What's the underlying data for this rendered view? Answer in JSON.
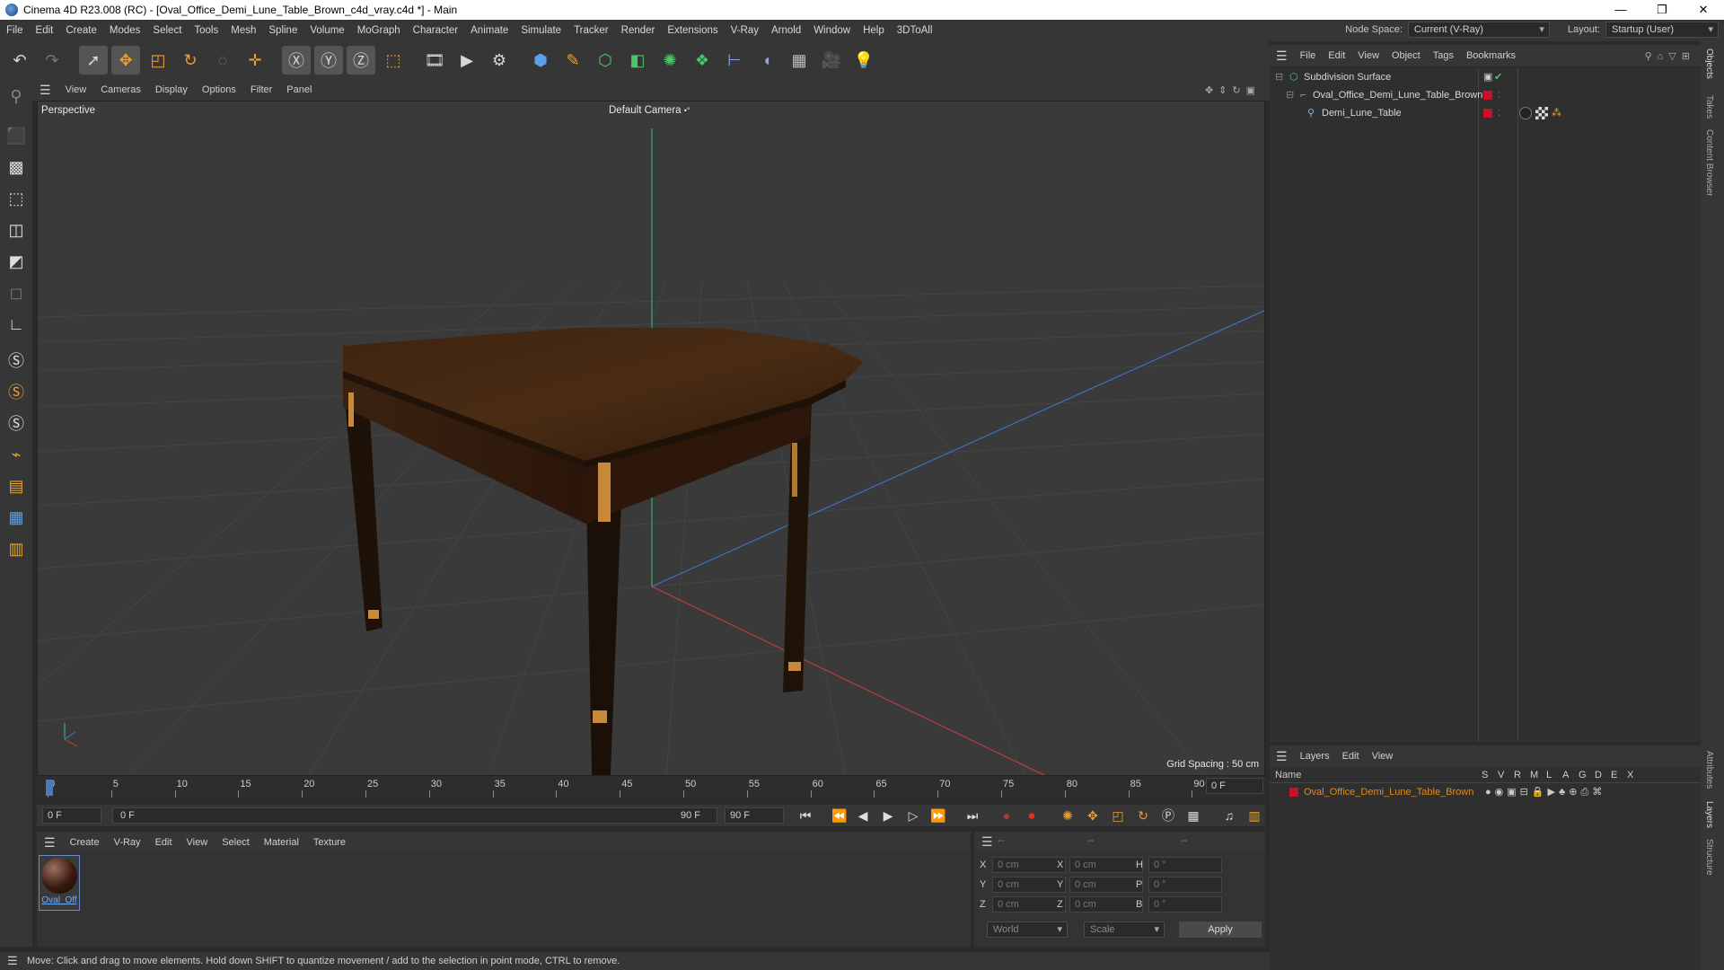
{
  "window": {
    "title": "Cinema 4D R23.008 (RC) - [Oval_Office_Demi_Lune_Table_Brown_c4d_vray.c4d *] - Main",
    "controls": [
      "—",
      "❐",
      "✕"
    ]
  },
  "menubar": {
    "items": [
      "File",
      "Edit",
      "Create",
      "Modes",
      "Select",
      "Tools",
      "Mesh",
      "Spline",
      "Volume",
      "MoGraph",
      "Character",
      "Animate",
      "Simulate",
      "Tracker",
      "Render",
      "Extensions",
      "V-Ray",
      "Arnold",
      "Window",
      "Help",
      "3DToAll"
    ],
    "node_space_label": "Node Space:",
    "node_space_value": "Current (V-Ray)",
    "layout_label": "Layout:",
    "layout_value": "Startup (User)"
  },
  "toolbar": {
    "icons": [
      "undo-icon",
      "redo-icon",
      "select-icon",
      "move-icon",
      "scale-icon",
      "rotate-icon",
      "live-select-icon",
      "axis-icon",
      "x-axis-icon",
      "y-axis-icon",
      "z-axis-icon",
      "coord-icon",
      "render-region-icon",
      "render-view-icon",
      "render-settings-icon",
      "cube-icon",
      "pen-icon",
      "subdivision-icon",
      "extrude-icon",
      "cloner-icon",
      "voronoi-icon",
      "ik-icon",
      "deformer-icon",
      "floor-icon",
      "camera-icon",
      "light-icon"
    ]
  },
  "viewport": {
    "menu": [
      "View",
      "Cameras",
      "Display",
      "Options",
      "Filter",
      "Panel"
    ],
    "label": "Perspective",
    "camera": "Default Camera",
    "camera_icon": "•°",
    "grid_spacing": "Grid Spacing : 50 cm"
  },
  "timeline": {
    "ticks": [
      "0",
      "5",
      "10",
      "15",
      "20",
      "25",
      "30",
      "35",
      "40",
      "45",
      "50",
      "55",
      "60",
      "65",
      "70",
      "75",
      "80",
      "85",
      "90"
    ],
    "frame_field": "0 F"
  },
  "transport": {
    "start": "0 F",
    "range_start": "0 F",
    "range_end": "90 F",
    "end": "90 F"
  },
  "materials": {
    "menu": [
      "Create",
      "V-Ray",
      "Edit",
      "View",
      "Select",
      "Material",
      "Texture"
    ],
    "items": [
      {
        "name": "Oval_Off"
      }
    ]
  },
  "coords": {
    "headers": [
      "--",
      "--",
      "--"
    ],
    "rows": [
      {
        "a": "X",
        "av": "0 cm",
        "b": "X",
        "bv": "0 cm",
        "c": "H",
        "cv": "0 °"
      },
      {
        "a": "Y",
        "av": "0 cm",
        "b": "Y",
        "bv": "0 cm",
        "c": "P",
        "cv": "0 °"
      },
      {
        "a": "Z",
        "av": "0 cm",
        "b": "Z",
        "bv": "0 cm",
        "c": "B",
        "cv": "0 °"
      }
    ],
    "mode1": "World",
    "mode2": "Scale",
    "apply": "Apply"
  },
  "status": "Move: Click and drag to move elements. Hold down SHIFT to quantize movement / add to the selection in point mode, CTRL to remove.",
  "objects": {
    "menu": [
      "File",
      "Edit",
      "View",
      "Object",
      "Tags",
      "Bookmarks"
    ],
    "rows": [
      {
        "name": "Subdivision Surface"
      },
      {
        "name": "Oval_Office_Demi_Lune_Table_Brown"
      },
      {
        "name": "Demi_Lune_Table"
      }
    ]
  },
  "layers": {
    "menu": [
      "Layers",
      "Edit",
      "View"
    ],
    "name_header": "Name",
    "flags": [
      "S",
      "V",
      "R",
      "M",
      "L",
      "A",
      "G",
      "D",
      "E",
      "X"
    ],
    "rows": [
      {
        "name": "Oval_Office_Demi_Lune_Table_Brown"
      }
    ]
  },
  "side_tabs": [
    "Objects",
    "Takes",
    "Content Browser",
    "Attributes",
    "Layers",
    "Structure"
  ],
  "colors": {
    "accent": "#e08a1e",
    "layer_red": "#c8102e",
    "x_axis": "#d04040",
    "y_axis": "#40c070",
    "z_axis": "#3a7bd5"
  }
}
